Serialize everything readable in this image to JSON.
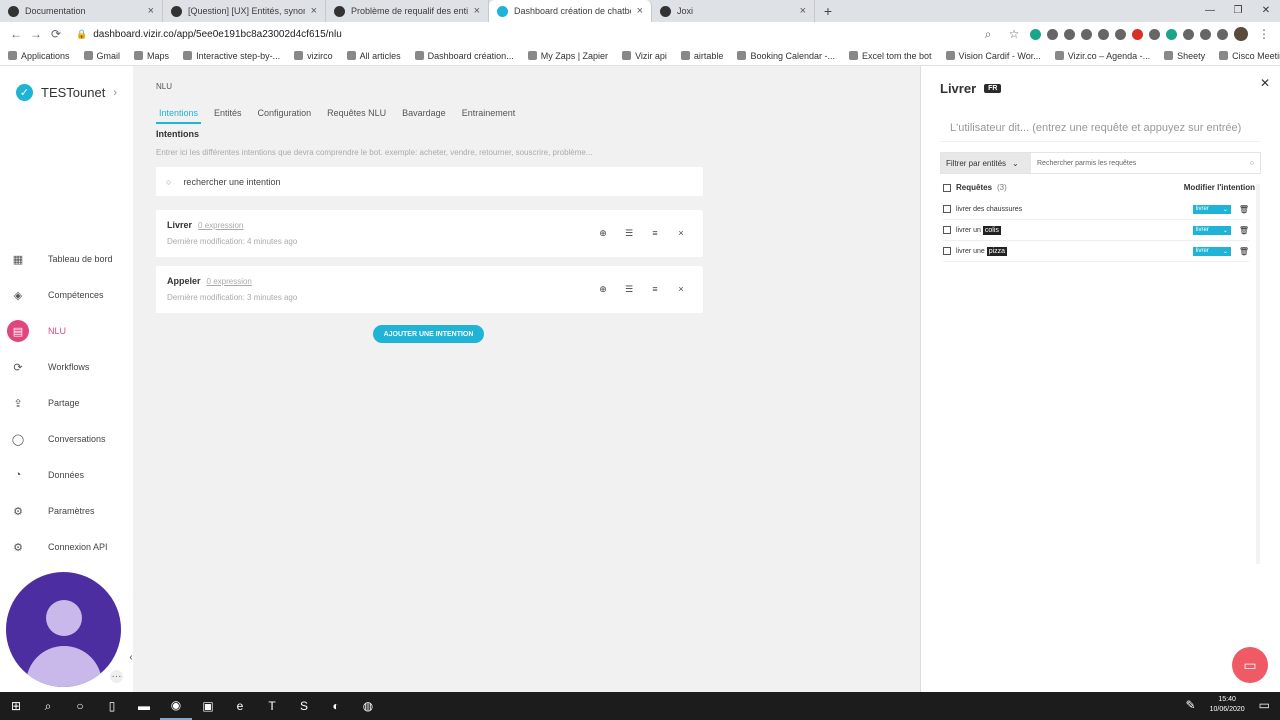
{
  "browser": {
    "tabs": [
      {
        "label": "Documentation",
        "active": false
      },
      {
        "label": "[Question] [UX] Entités, synonym",
        "active": false
      },
      {
        "label": "Problème de requalif des entités",
        "active": false
      },
      {
        "label": "Dashboard création de chatbot",
        "active": true
      },
      {
        "label": "Joxi",
        "active": false
      }
    ],
    "url": "dashboard.vizir.co/app/5ee0e191bc8a23002d4cf615/nlu",
    "bookmarks": [
      "Applications",
      "Gmail",
      "Maps",
      "Interactive step-by-...",
      "vizirco",
      "All articles",
      "Dashboard création...",
      "My Zaps | Zapier",
      "Vizir api",
      "airtable",
      "Booking Calendar -...",
      "Excel tom the bot",
      "Vision Cardif - Wor...",
      "Vizir.co – Agenda -...",
      "Sheety",
      "Cisco Meeting App"
    ]
  },
  "sidebar": {
    "brand": "TESTounet",
    "items": [
      {
        "label": "Tableau de bord",
        "icon": "grid-icon",
        "glyph": "▦"
      },
      {
        "label": "Compétences",
        "icon": "layers-icon",
        "glyph": "◈"
      },
      {
        "label": "NLU",
        "icon": "database-icon",
        "glyph": "▤"
      },
      {
        "label": "Workflows",
        "icon": "sync-icon",
        "glyph": "⟳"
      },
      {
        "label": "Partage",
        "icon": "share-icon",
        "glyph": "⇪"
      },
      {
        "label": "Conversations",
        "icon": "chat-icon",
        "glyph": "◯"
      },
      {
        "label": "Données",
        "icon": "clock-icon",
        "glyph": "◔"
      },
      {
        "label": "Paramètres",
        "icon": "gear-icon",
        "glyph": "⚙"
      },
      {
        "label": "Connexion API",
        "icon": "gear-icon",
        "glyph": "⚙"
      }
    ],
    "active_index": 2
  },
  "main": {
    "breadcrumb": "NLU",
    "tabs": [
      "Intentions",
      "Entités",
      "Configuration",
      "Requêtes NLU",
      "Bavardage",
      "Entrainement"
    ],
    "active_tab": 0,
    "section_title": "Intentions",
    "hint": "Entrer ici les différentes intentions que devra comprendre le bot. exemple: acheter, vendre, retourner, souscrire, problème...",
    "search_placeholder": "rechercher une intention",
    "intents": [
      {
        "name": "Livrer",
        "expressions": "0 expression",
        "modified": "Dernière modification: 4 minutes ago"
      },
      {
        "name": "Appeler",
        "expressions": "0 expression",
        "modified": "Dernière modification: 3 minutes ago"
      }
    ],
    "add_button": "AJOUTER UNE INTENTION"
  },
  "panel": {
    "title": "Livrer",
    "lang": "FR",
    "input_placeholder": "L'utilisateur dit... (entrez une requête et appuyez sur entrée)",
    "filter_label": "Filtrer par entités",
    "search_placeholder": "Rechercher parmis les requêtes",
    "header_label": "Requêtes",
    "header_count": "(3)",
    "header_right": "Modifier l'intention",
    "queries": [
      {
        "before": "livrer des chaussures",
        "entity": "",
        "intent": "livrer"
      },
      {
        "before": "livrer un ",
        "entity": "colis",
        "intent": "livrer"
      },
      {
        "before": "livrer une ",
        "entity": "pizza",
        "intent": "livrer"
      }
    ]
  },
  "taskbar": {
    "time": "15:40",
    "date": "10/06/2020"
  }
}
